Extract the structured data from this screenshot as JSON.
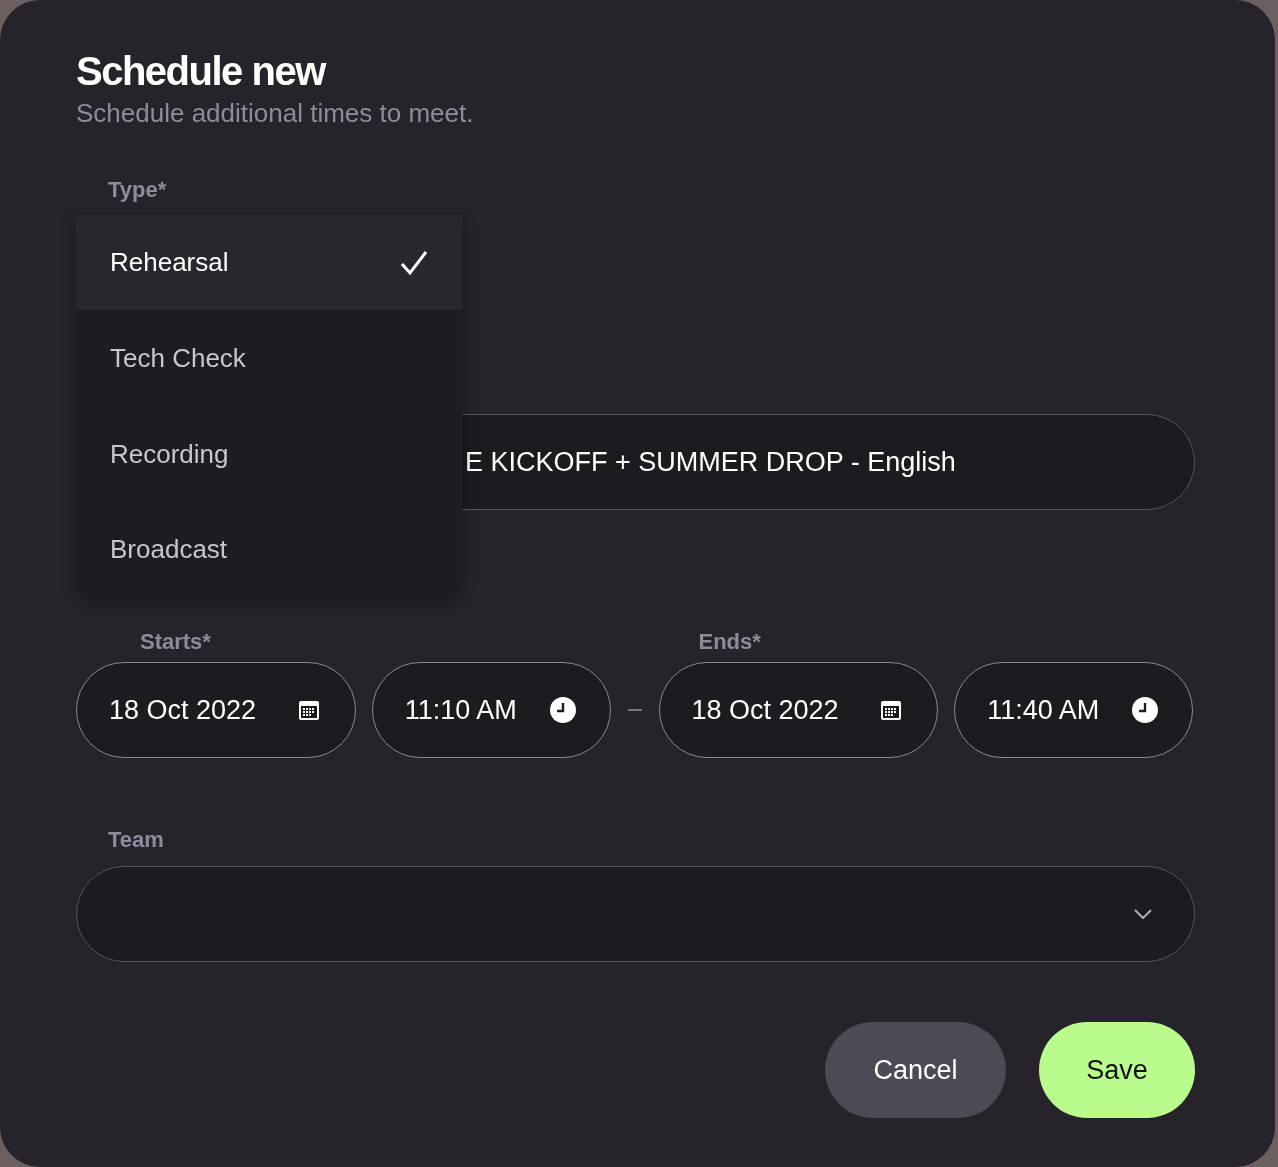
{
  "dialog": {
    "title": "Schedule new",
    "subtitle": "Schedule additional times to meet."
  },
  "type_field": {
    "label": "Type*",
    "options": [
      {
        "label": "Rehearsal",
        "selected": true
      },
      {
        "label": "Tech Check",
        "selected": false
      },
      {
        "label": "Recording",
        "selected": false
      },
      {
        "label": "Broadcast",
        "selected": false
      }
    ]
  },
  "field_2": {
    "value": "E KICKOFF + SUMMER DROP - English"
  },
  "starts": {
    "label": "Starts*",
    "date": "18 Oct 2022",
    "time": "11:10 AM"
  },
  "ends": {
    "label": "Ends*",
    "date": "18 Oct 2022",
    "time": "11:40 AM"
  },
  "team": {
    "label": "Team"
  },
  "buttons": [
    {
      "label": "Cancel",
      "kind": "secondary"
    },
    {
      "label": "Save",
      "kind": "primary"
    }
  ]
}
